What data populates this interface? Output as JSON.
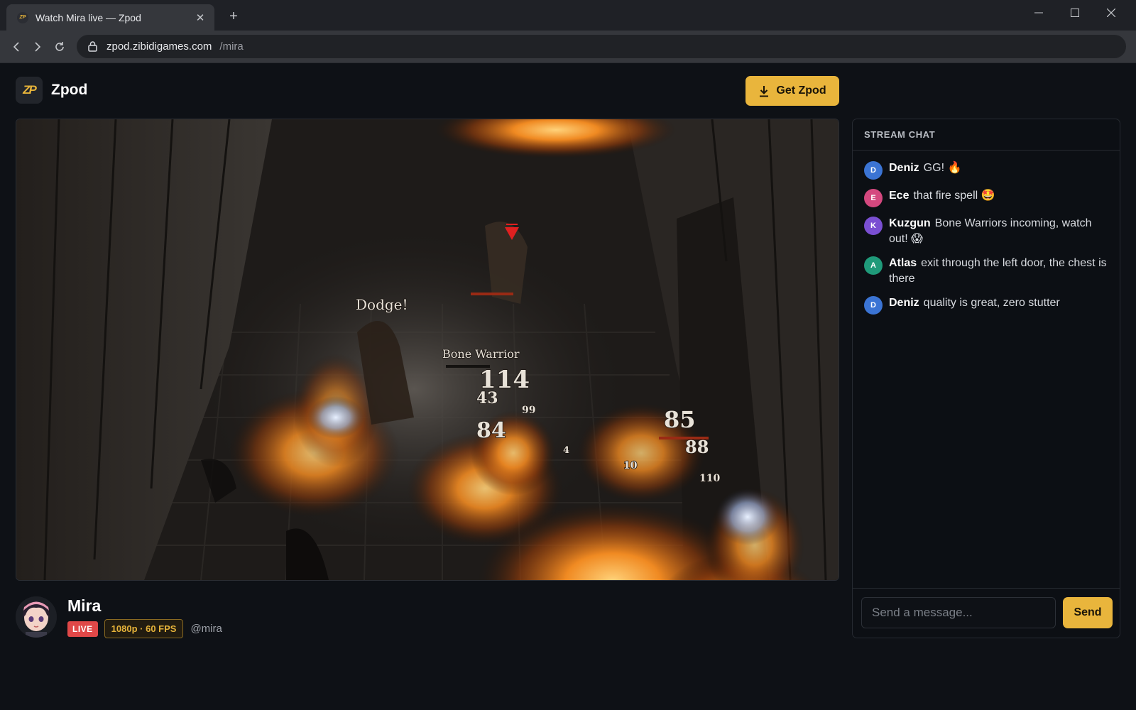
{
  "browser": {
    "tab_title": "Watch Mira live — Zpod",
    "tab_favicon_text": "ZP",
    "new_tab_symbol": "+",
    "url_host": "zpod.zibidigames.com",
    "url_path": "/mira"
  },
  "header": {
    "logo_text": "ZP",
    "brand_name": "Zpod",
    "get_button_label": "Get Zpod",
    "accent_color": "#e9b53c"
  },
  "stream": {
    "streamer_name": "Mira",
    "live_label": "LIVE",
    "quality_label": "1080p · 60 FPS",
    "handle": "@mira",
    "game_overlay": {
      "dodge_text": "Dodge!",
      "enemy_name": "Bone Warrior",
      "damage_numbers": [
        "114",
        "43",
        "99",
        "84",
        "85",
        "88",
        "4",
        "10",
        "110"
      ]
    }
  },
  "chat": {
    "header": "STREAM CHAT",
    "messages": [
      {
        "initial": "D",
        "user": "Deniz",
        "text": "GG! 🔥",
        "color": "#3b74d4"
      },
      {
        "initial": "E",
        "user": "Ece",
        "text": "that fire spell 🤩",
        "color": "#d4487f"
      },
      {
        "initial": "K",
        "user": "Kuzgun",
        "text": "Bone Warriors incoming, watch out! 😱",
        "color": "#7a4fd2"
      },
      {
        "initial": "A",
        "user": "Atlas",
        "text": "exit through the left door, the chest is there",
        "color": "#1f9a7a"
      },
      {
        "initial": "D",
        "user": "Deniz",
        "text": "quality is great, zero stutter",
        "color": "#3b74d4"
      }
    ],
    "input_placeholder": "Send a message...",
    "send_label": "Send"
  }
}
